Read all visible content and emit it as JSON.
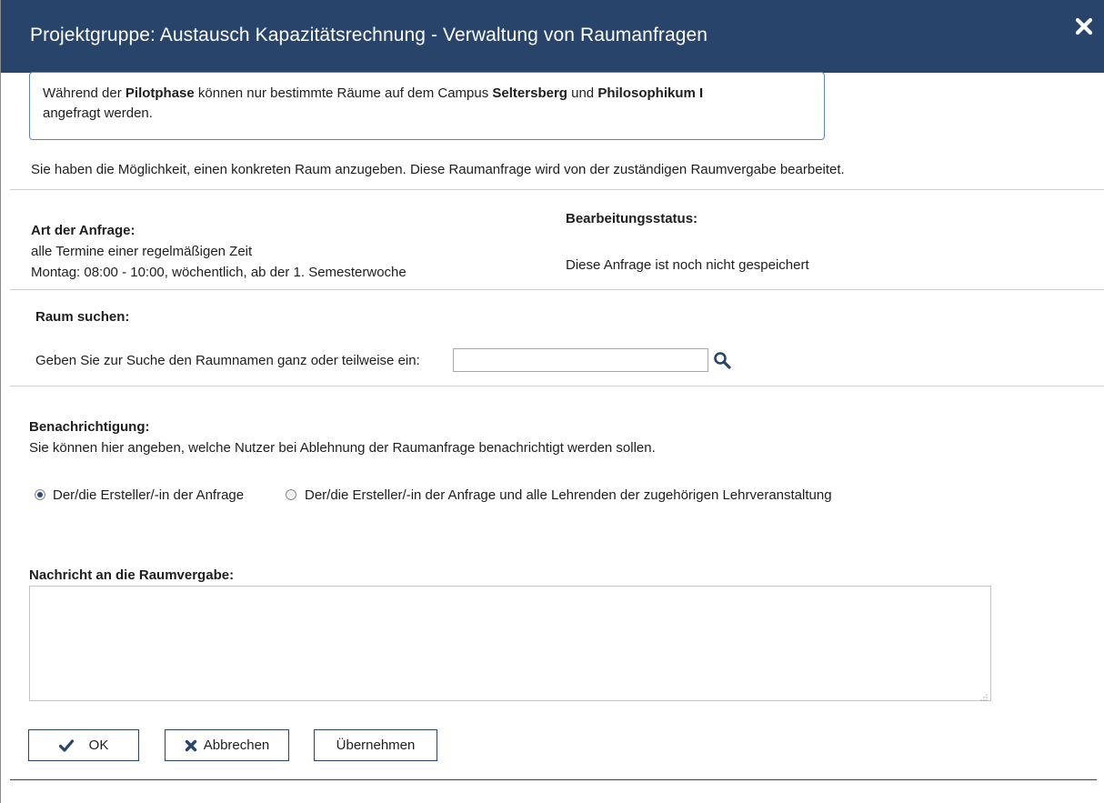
{
  "dialog": {
    "title": "Projektgruppe: Austausch Kapazitätsrechnung - Verwaltung von Raumanfragen"
  },
  "info": {
    "part1": "Während der ",
    "bold1": "Pilotphase",
    "part2": " können nur bestimmte Räume auf dem Campus ",
    "bold2": "Seltersberg",
    "part3": " und ",
    "bold3": "Philosophikum I",
    "line2": "angefragt werden."
  },
  "intro": "Sie haben die Möglichkeit, einen konkreten Raum anzugeben. Diese Raumanfrage wird von der zuständigen Raumvergabe bearbeitet.",
  "request": {
    "type_label": "Art der Anfrage:",
    "type_value": "alle Termine einer regelmäßigen Zeit",
    "schedule": "Montag: 08:00 - 10:00, wöchentlich, ab der 1. Semesterwoche",
    "status_label": "Bearbeitungsstatus:",
    "status_value": "Diese Anfrage ist noch nicht gespeichert"
  },
  "search": {
    "heading": "Raum suchen:",
    "prompt": "Geben Sie zur Suche den Raumnamen ganz oder teilweise ein:",
    "value": ""
  },
  "notification": {
    "label": "Benachrichtigung:",
    "description": "Sie können hier angeben, welche Nutzer bei Ablehnung der Raumanfrage benachrichtigt werden sollen.",
    "options": [
      {
        "label": "Der/die Ersteller/-in der Anfrage",
        "selected": true
      },
      {
        "label": "Der/die Ersteller/-in der Anfrage und alle Lehrenden der zugehörigen Lehrveranstaltung",
        "selected": false
      }
    ]
  },
  "message": {
    "label": "Nachricht an die Raumvergabe:",
    "value": ""
  },
  "buttons": {
    "ok": "OK",
    "cancel": "Abbrechen",
    "apply": "Übernehmen"
  },
  "colors": {
    "header_bg": "#28446b",
    "accent": "#28446b"
  }
}
